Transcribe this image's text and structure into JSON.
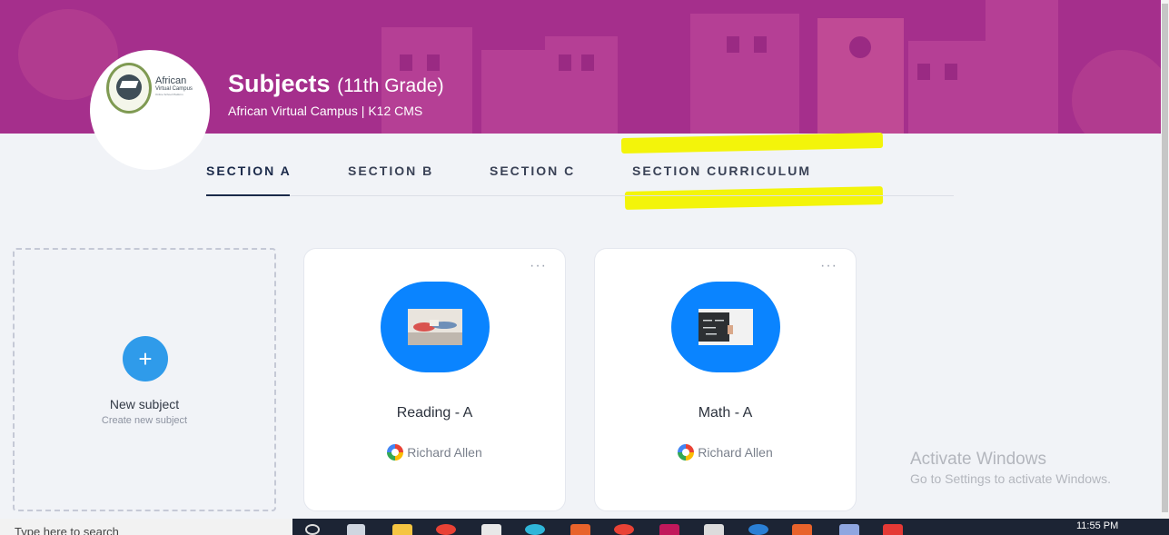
{
  "header": {
    "title": "Subjects",
    "grade": "(11th Grade)",
    "subtitle": "African Virtual Campus | K12 CMS",
    "logo": {
      "word": "African",
      "sub": "Virtual Campus",
      "tagline": "Online School Platform",
      "seal_text": "African Virtual Campus"
    }
  },
  "tabs": [
    {
      "label": "SECTION A",
      "active": true
    },
    {
      "label": "SECTION B",
      "active": false
    },
    {
      "label": "SECTION C",
      "active": false
    },
    {
      "label": "SECTION CURRICULUM",
      "active": false
    }
  ],
  "new_subject": {
    "plus": "+",
    "label": "New subject",
    "sublabel": "Create new subject"
  },
  "subjects": [
    {
      "title": "Reading - A",
      "teacher": "Richard Allen",
      "menu": "···"
    },
    {
      "title": "Math - A",
      "teacher": "Richard Allen",
      "menu": "···"
    }
  ],
  "watermark": {
    "title": "Activate Windows",
    "subtitle": "Go to Settings to activate Windows."
  },
  "taskbar": {
    "search_text": "Type here to search",
    "clock": "11:55 PM"
  },
  "colors": {
    "banner": "#a52f8c",
    "accent": "#0a84ff",
    "plus_button": "#2f9bea",
    "highlight": "#f3f40a"
  }
}
